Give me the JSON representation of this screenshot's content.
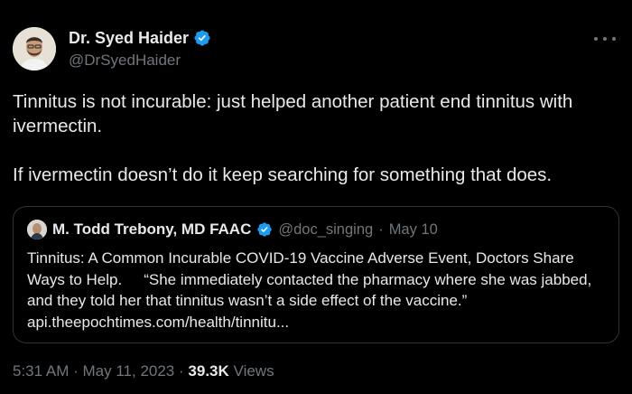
{
  "author": {
    "display_name": "Dr. Syed Haider",
    "handle": "@DrSyedHaider"
  },
  "body": {
    "paragraph1": "Tinnitus is not incurable: just helped another patient end tinnitus with ivermectin.",
    "paragraph2": "If ivermectin doesn’t do it keep searching for something that does."
  },
  "quoted_tweet": {
    "display_name": "M. Todd Trebony, MD FAAC",
    "handle": "@doc_singing",
    "separator": "·",
    "date": "May 10",
    "text_part1": "Tinnitus: A Common Incurable COVID-19 Vaccine Adverse Event, Doctors Share Ways to Help.",
    "text_part2": "“She immediately contacted the pharmacy where she was jabbed, and they told her that tinnitus wasn’t a side effect of the vaccine.”",
    "link": "api.theepochtimes.com/health/tinnitu..."
  },
  "footer": {
    "time": "5:31 AM",
    "sep1": "·",
    "date": "May 11, 2023",
    "sep2": "·",
    "views_count": "39.3K",
    "views_label": "Views"
  },
  "colors": {
    "background": "#000000",
    "text": "#e7e9ea",
    "secondary": "#71767b",
    "verified": "#1d9bf0",
    "border": "#2f3336"
  },
  "icons": {
    "verified": "verified-badge-icon",
    "more": "more-options-icon"
  }
}
